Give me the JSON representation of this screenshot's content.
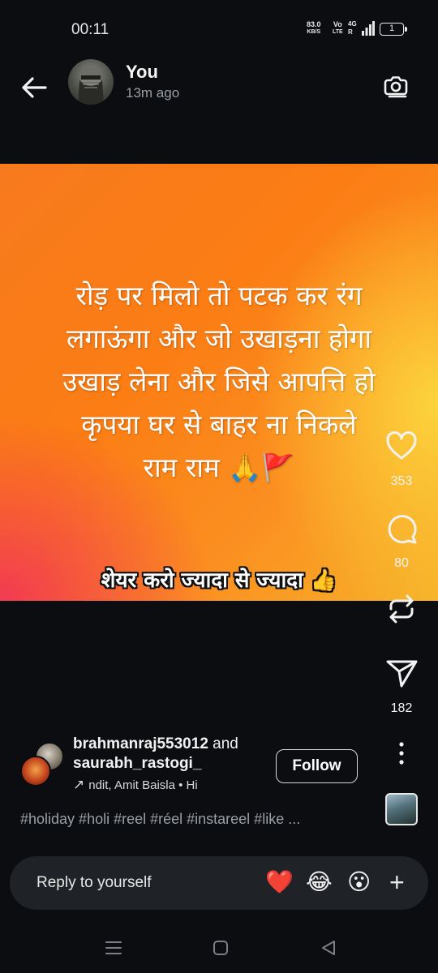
{
  "status_bar": {
    "time": "00:11",
    "speed_value": "83.0",
    "speed_unit": "KB/S",
    "volte_top": "Vo",
    "volte_bottom": "LTE",
    "network_top": "4G",
    "network_bottom": "R",
    "battery": "1"
  },
  "header": {
    "back_icon": "arrow-left-icon",
    "username": "You",
    "time_ago": "13m ago",
    "camera_icon": "camera-icon"
  },
  "post": {
    "quote_lines": [
      "रोड़ पर मिलो तो पटक कर रंग",
      "लगाऊंगा और जो उखाड़ना होगा",
      "उखाड़ लेना और जिसे आपत्ति हो",
      "कृपया घर से बाहर ना निकले",
      "राम राम 🙏🚩"
    ],
    "cta": "शेयर करो ज्यादा से ज्यादा 👍",
    "gradient_colors": [
      "#f23a52",
      "#fb7d14",
      "#fcd43c"
    ]
  },
  "actions": {
    "likes": "353",
    "comments": "80",
    "shares": "182"
  },
  "attribution": {
    "user1": "brahmanraj553012",
    "and_text": "and",
    "user2": "saurabh_rastogi_",
    "audio_arrow": "↗",
    "audio_text": "ndit, Amit Baisla • Hi",
    "follow_label": "Follow"
  },
  "caption": {
    "hashtags": "#holiday #holi #reel #réel #instareel #like ..."
  },
  "reply": {
    "placeholder": "Reply to yourself",
    "emoji_1": "❤️",
    "emoji_2": "😂",
    "emoji_3": "😮",
    "plus": "+"
  }
}
